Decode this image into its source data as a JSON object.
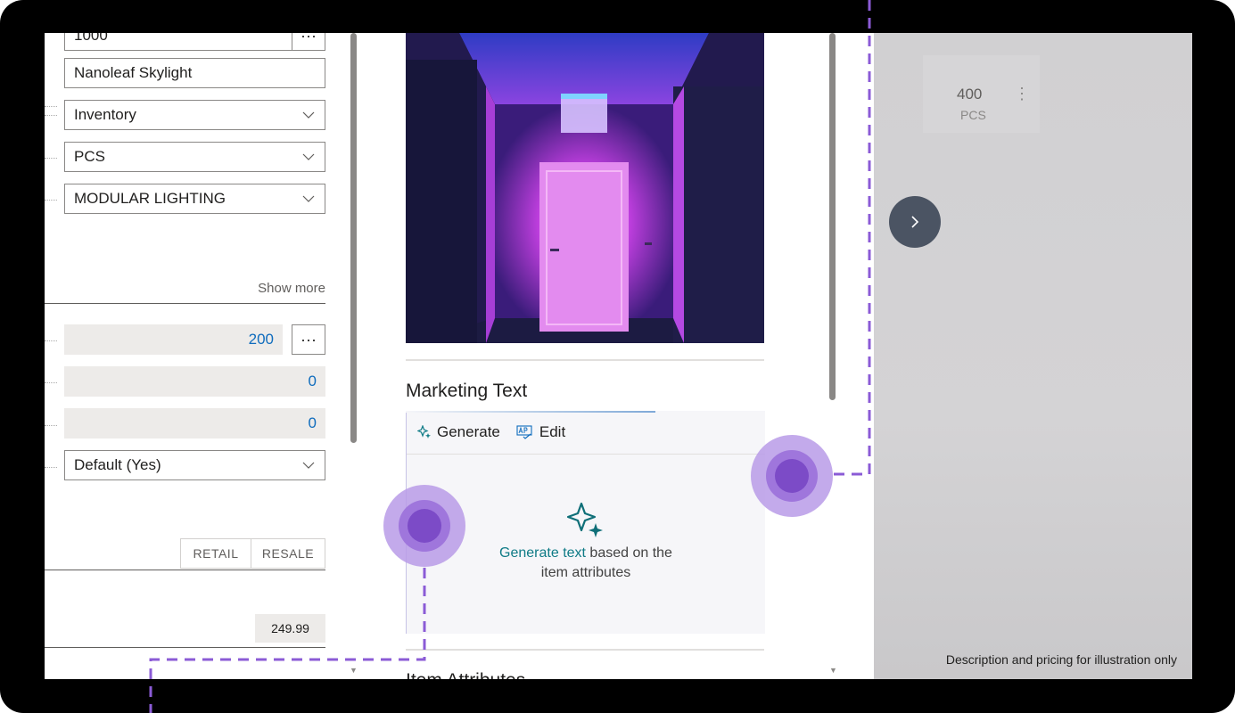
{
  "form": {
    "number_value": "1000",
    "description_value": "Nanoleaf Skylight",
    "type_value": "Inventory",
    "base_uom_value": "PCS",
    "category_value": "MODULAR LIGHTING",
    "show_more_label": "Show more",
    "inventory_value": "200",
    "qty_po_value": "0",
    "qty_so_value": "0",
    "stockout_value": "Default (Yes)",
    "price_tab_retail": "RETAIL",
    "price_tab_resale": "RESALE",
    "unit_price_value": "249.99",
    "lookup_label": "···"
  },
  "marketing": {
    "title": "Marketing Text",
    "generate_label": "Generate",
    "edit_label": "Edit",
    "empty_link": "Generate text",
    "empty_rest_line1": " based on the",
    "empty_line2": "item attributes",
    "attributes_title": "Item Attributes",
    "icons": [
      "sparkle-icon",
      "spellcheck-icon",
      "copilot-sparkle-icon"
    ]
  },
  "factbox": {
    "quantity": "400",
    "uom": "PCS",
    "menu_glyph": "⋮",
    "disclaimer": "Description and pricing for illustration only"
  },
  "colors": {
    "accent_link": "#0f7b86",
    "annotation": "#8b5bd6",
    "touch_outer": "#b99be8",
    "touch_inner": "#7c4bc7",
    "nav_button": "#4b5463"
  }
}
